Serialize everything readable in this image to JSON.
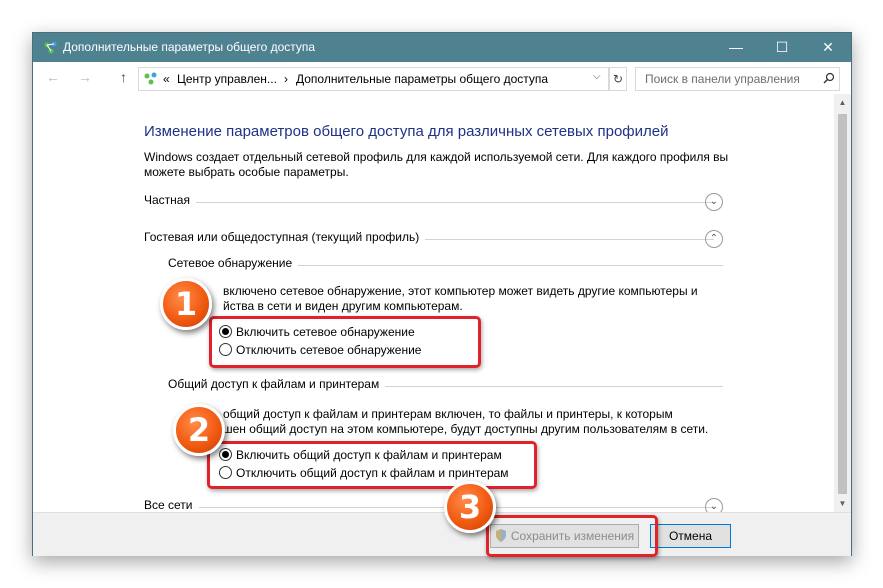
{
  "window": {
    "title": "Дополнительные параметры общего доступа",
    "controls": {
      "minimize": "—",
      "maximize": "☐",
      "close": "✕"
    }
  },
  "address_bar": {
    "back": "←",
    "forward": "→",
    "up": "↑",
    "breadcrumb_prefix": "«",
    "crumb1": "Центр управлен...",
    "separator": "›",
    "crumb2": "Дополнительные параметры общего доступа",
    "dropdown": "⌵",
    "refresh": "↻",
    "search_placeholder": "Поиск в панели управления"
  },
  "content": {
    "title": "Изменение параметров общего доступа для различных сетевых профилей",
    "description": "Windows создает отдельный сетевой профиль для каждой используемой сети. Для каждого профиля вы можете выбрать особые параметры.",
    "profiles": [
      {
        "label": "Частная",
        "chevron": "⌄"
      },
      {
        "label": "Гостевая или общедоступная (текущий профиль)",
        "chevron": "⌃"
      },
      {
        "label": "Все сети",
        "chevron": "⌄"
      }
    ],
    "network_discovery": {
      "heading": "Сетевое обнаружение",
      "text_line1": "включено сетевое обнаружение, этот компьютер может видеть другие компьютеры и",
      "text_line2": "йства в сети и виден другим компьютерам.",
      "options": [
        {
          "label": "Включить сетевое обнаружение",
          "checked": true
        },
        {
          "label": "Отключить сетевое обнаружение",
          "checked": false
        }
      ]
    },
    "file_sharing": {
      "heading": "Общий доступ к файлам и принтерам",
      "text_line1": "общий доступ к файлам и принтерам включен, то файлы и принтеры, к которым",
      "text_line2": "шен общий доступ на этом компьютере, будут доступны другим пользователям в сети.",
      "options": [
        {
          "label": "Включить общий доступ к файлам и принтерам",
          "checked": true
        },
        {
          "label": "Отключить общий доступ к файлам и принтерам",
          "checked": false
        }
      ]
    }
  },
  "scrollbar": {
    "up": "▲",
    "down": "▼"
  },
  "footer": {
    "save_label": "Сохранить изменения",
    "save_enabled": false,
    "cancel_label": "Отмена"
  },
  "annotations": {
    "steps": [
      "1",
      "2",
      "3"
    ],
    "highlight_color": "#e0232a",
    "badge_color": "#f25a12"
  },
  "colors": {
    "titlebar": "#4f8291",
    "heading_blue": "#1e3287"
  }
}
